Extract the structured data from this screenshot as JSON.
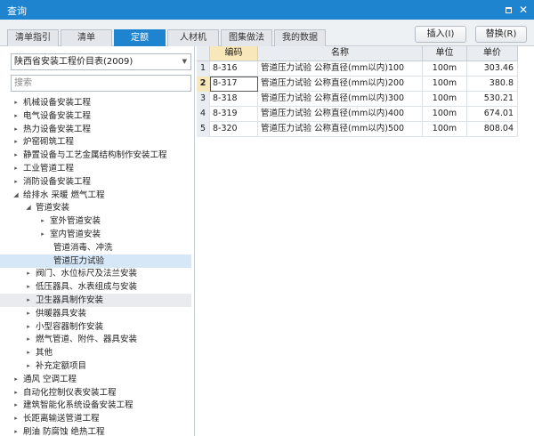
{
  "window": {
    "title": "查询"
  },
  "tabs": [
    {
      "label": "清单指引"
    },
    {
      "label": "清单"
    },
    {
      "label": "定额"
    },
    {
      "label": "人材机"
    },
    {
      "label": "图集做法"
    },
    {
      "label": "我的数据"
    }
  ],
  "active_tab": 2,
  "buttons": {
    "insert": "插入(I)",
    "replace": "替换(R)"
  },
  "left": {
    "library_select": "陕西省安装工程价目表(2009)",
    "search_placeholder": "搜索",
    "tree": [
      {
        "label": "机械设备安装工程",
        "level": 0,
        "toggle": "collapsed"
      },
      {
        "label": "电气设备安装工程",
        "level": 0,
        "toggle": "collapsed"
      },
      {
        "label": "热力设备安装工程",
        "level": 0,
        "toggle": "collapsed"
      },
      {
        "label": "炉窑砌筑工程",
        "level": 0,
        "toggle": "collapsed"
      },
      {
        "label": "静置设备与工艺金属结构制作安装工程",
        "level": 0,
        "toggle": "collapsed"
      },
      {
        "label": "工业管道工程",
        "level": 0,
        "toggle": "collapsed"
      },
      {
        "label": "消防设备安装工程",
        "level": 0,
        "toggle": "collapsed"
      },
      {
        "label": "给排水 采暖 燃气工程",
        "level": 0,
        "toggle": "expanded"
      },
      {
        "label": "管道安装",
        "level": 1,
        "toggle": "expanded"
      },
      {
        "label": "室外管道安装",
        "level": 2,
        "toggle": "collapsed"
      },
      {
        "label": "室内管道安装",
        "level": 2,
        "toggle": "collapsed"
      },
      {
        "label": "管道消毒、冲洗",
        "level": 2,
        "toggle": "none"
      },
      {
        "label": "管道压力试验",
        "level": 2,
        "toggle": "none",
        "state": "selected"
      },
      {
        "label": "阀门、水位标尺及法兰安装",
        "level": 1,
        "toggle": "collapsed"
      },
      {
        "label": "低压器具、水表组成与安装",
        "level": 1,
        "toggle": "collapsed"
      },
      {
        "label": "卫生器具制作安装",
        "level": 1,
        "toggle": "collapsed",
        "state": "hovered"
      },
      {
        "label": "供暖器具安装",
        "level": 1,
        "toggle": "collapsed"
      },
      {
        "label": "小型容器制作安装",
        "level": 1,
        "toggle": "collapsed"
      },
      {
        "label": "燃气管道、附件、器具安装",
        "level": 1,
        "toggle": "collapsed"
      },
      {
        "label": "其他",
        "level": 1,
        "toggle": "collapsed"
      },
      {
        "label": "补充定额项目",
        "level": 1,
        "toggle": "collapsed"
      },
      {
        "label": "通风 空调工程",
        "level": 0,
        "toggle": "collapsed"
      },
      {
        "label": "自动化控制仪表安装工程",
        "level": 0,
        "toggle": "collapsed"
      },
      {
        "label": "建筑智能化系统设备安装工程",
        "level": 0,
        "toggle": "collapsed"
      },
      {
        "label": "长距离输送管道工程",
        "level": 0,
        "toggle": "collapsed"
      },
      {
        "label": "刷油 防腐蚀 绝热工程",
        "level": 0,
        "toggle": "collapsed"
      }
    ]
  },
  "table": {
    "columns": [
      "编码",
      "名称",
      "单位",
      "单价"
    ],
    "selected_row": 1,
    "rows": [
      {
        "no": "1",
        "code": "8-316",
        "name": "管道压力试验 公称直径(mm以内)100",
        "unit": "100m",
        "price": "303.46"
      },
      {
        "no": "2",
        "code": "8-317",
        "name": "管道压力试验 公称直径(mm以内)200",
        "unit": "100m",
        "price": "380.8"
      },
      {
        "no": "3",
        "code": "8-318",
        "name": "管道压力试验 公称直径(mm以内)300",
        "unit": "100m",
        "price": "530.21"
      },
      {
        "no": "4",
        "code": "8-319",
        "name": "管道压力试验 公称直径(mm以内)400",
        "unit": "100m",
        "price": "674.01"
      },
      {
        "no": "5",
        "code": "8-320",
        "name": "管道压力试验 公称直径(mm以内)500",
        "unit": "100m",
        "price": "808.04"
      }
    ]
  },
  "icons": {
    "maximize": "maximize-icon",
    "close": "close-icon",
    "dropdown": "chevron-down-icon",
    "tree_collapsed": "triangle-right-icon",
    "tree_expanded": "triangle-down-icon"
  },
  "colors": {
    "accent": "#1e84cf",
    "selection": "#d6e8f7",
    "header_selected": "#f8e7b9"
  }
}
